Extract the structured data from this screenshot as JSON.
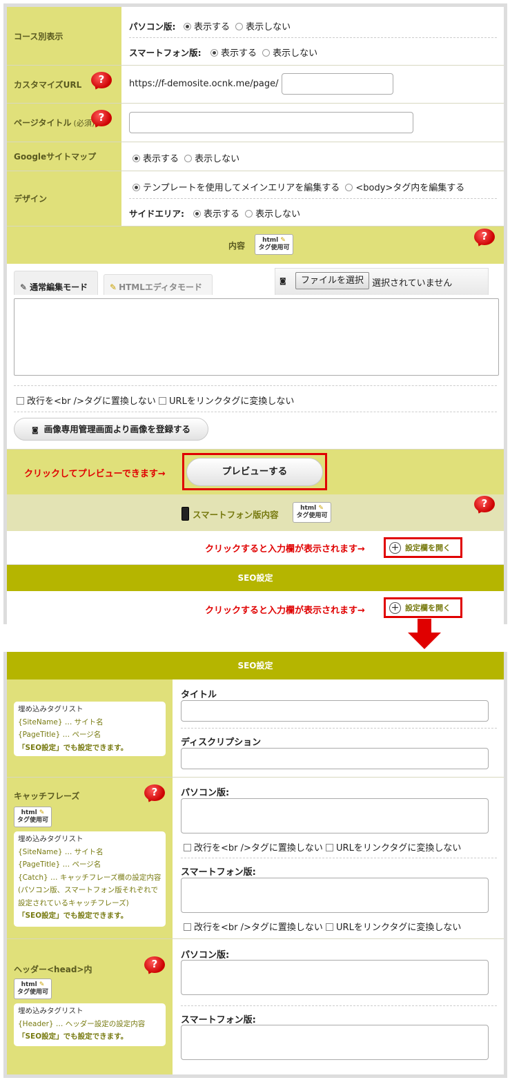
{
  "course": {
    "label": "コース別表示",
    "pc_label": "パソコン版:",
    "sp_label": "スマートフォン版:",
    "show": "表示する",
    "hide": "表示しない"
  },
  "custom_url": {
    "label": "カスタマイズURL",
    "prefix": "https://f-demosite.ocnk.me/page/"
  },
  "page_title": {
    "label": "ページタイトル",
    "required": "(必須)"
  },
  "sitemap": {
    "label": "Googleサイトマップ",
    "show": "表示する",
    "hide": "表示しない"
  },
  "design": {
    "label": "デザイン",
    "opt_template": "テンプレートを使用してメインエリアを編集する",
    "opt_body": "<body>タグ内を編集する",
    "side_label": "サイドエリア:",
    "show": "表示する",
    "hide": "表示しない"
  },
  "content": {
    "label": "内容",
    "badge_line1": "html",
    "badge_line2": "タグ使用可",
    "tab_normal": "通常編集モード",
    "tab_html": "HTMLエディタモード",
    "file_button": "ファイルを選択",
    "file_status": "選択されていません",
    "opt_br": "改行を<br />タグに置換しない",
    "opt_url": "URLをリンクタグに変換しない",
    "register_image": "画像専用管理画面より画像を登録する"
  },
  "preview": {
    "hint": "クリックしてプレビューできます→",
    "button": "プレビューする"
  },
  "smartphone": {
    "label": "スマートフォン版内容",
    "hint": "クリックすると入力欄が表示されます→",
    "open": "設定欄を開く"
  },
  "seo": {
    "header": "SEO設定",
    "hint": "クリックすると入力欄が表示されます→",
    "open": "設定欄を開く"
  },
  "seo_detail": {
    "header": "SEO設定",
    "taglist_title": "埋め込みタグリスト",
    "tag_sitename": "{SiteName} … サイト名",
    "tag_pagetitle": "{PageTitle} … ページ名",
    "tag_catch": "{Catch} … キャッチフレーズ欄の設定内容 (パソコン版、スマートフォン版それぞれで設定されているキャッチフレーズ)",
    "tag_header": "{Header} … ヘッダー設定の設定内容",
    "seo_note": "「SEO設定」でも設定できます。",
    "title_label": "タイトル",
    "desc_label": "ディスクリプション",
    "catch_label": "キャッチフレーズ",
    "head_label": "ヘッダー<head>内",
    "pc_label": "パソコン版:",
    "sp_label": "スマートフォン版:",
    "opt_br": "改行を<br />タグに置換しない",
    "opt_url": "URLをリンクタグに変換しない"
  },
  "colors": {
    "label_bg": "#e0e07a",
    "seo_bg": "#b5b500",
    "accent_red": "#e00000",
    "olive_text": "#777a10"
  }
}
